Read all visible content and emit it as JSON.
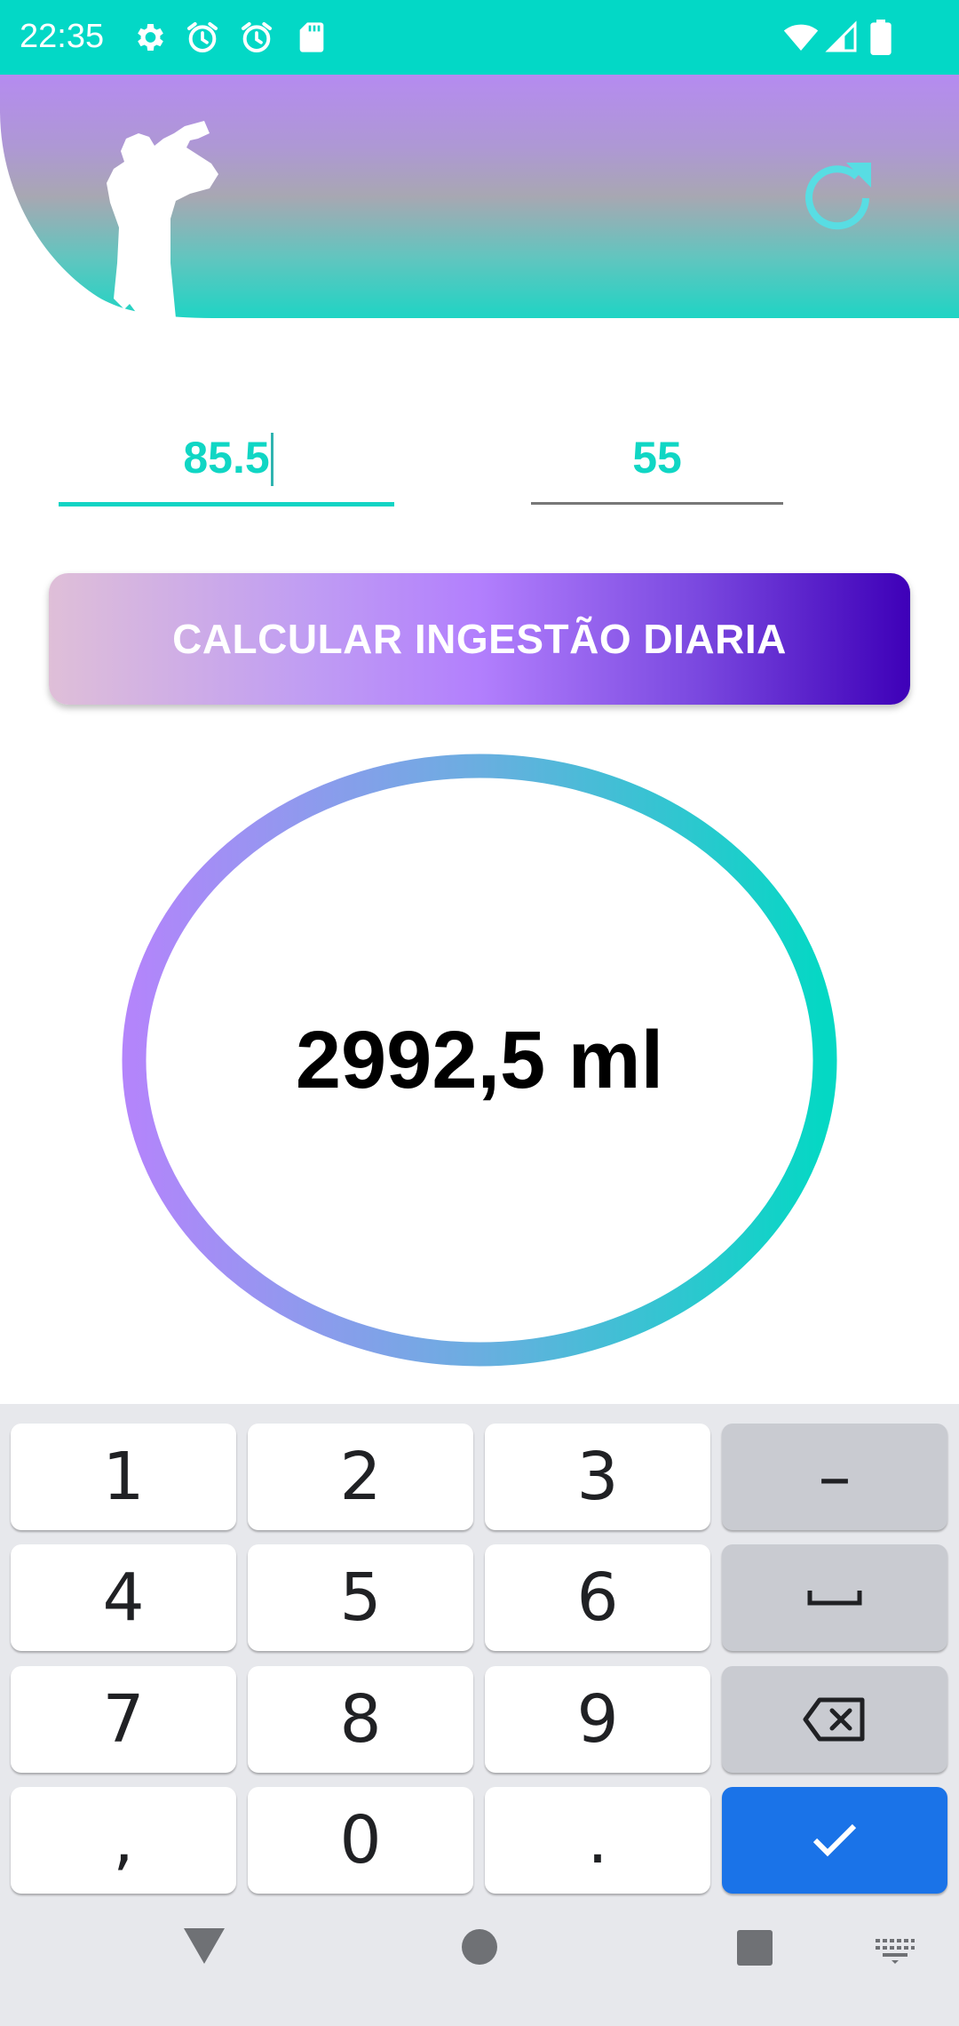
{
  "status_bar": {
    "time": "22:35",
    "icons": [
      "gear-icon",
      "alarm-icon",
      "alarm-icon",
      "sd-card-icon",
      "wifi-icon",
      "signal-icon",
      "battery-icon"
    ]
  },
  "colors": {
    "accent": "#03d8c6",
    "header_top": "#b58bf0",
    "header_bottom": "#1fd4c4",
    "button_start": "#dfbfd8",
    "button_end": "#3e00b8",
    "enter_key": "#1a73e8"
  },
  "header": {
    "illustration": "person-drinking-icon",
    "refresh": "refresh-icon"
  },
  "form": {
    "weight_value": "85.5",
    "age_value": "55"
  },
  "calculate_button": {
    "label": "CALCULAR INGESTÃO DIARIA"
  },
  "result": {
    "text": "2992,5 ml"
  },
  "keyboard": {
    "keys": [
      "1",
      "2",
      "3",
      "–",
      "4",
      "5",
      "6",
      "space-icon",
      "7",
      "8",
      "9",
      "backspace-icon",
      ",",
      "0",
      ".",
      "check-icon"
    ]
  },
  "navigation": {
    "buttons": [
      "back-icon",
      "home-icon",
      "recents-icon",
      "keyboard-icon"
    ]
  }
}
